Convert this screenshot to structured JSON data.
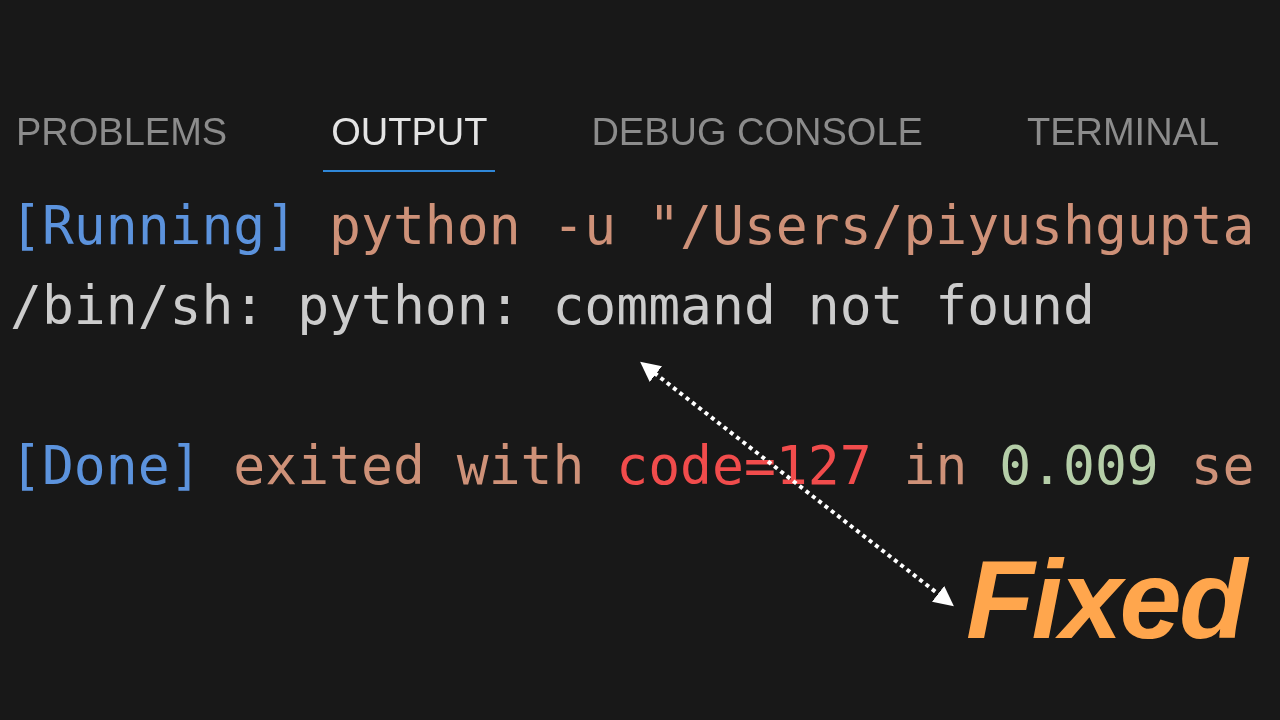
{
  "tabs": [
    {
      "label": "PROBLEMS",
      "selected": false
    },
    {
      "label": "OUTPUT",
      "selected": true
    },
    {
      "label": "DEBUG CONSOLE",
      "selected": false
    },
    {
      "label": "TERMINAL",
      "selected": false
    }
  ],
  "output_lines": [
    {
      "kind": "text",
      "segments": [
        {
          "kind": "tag",
          "text": "[Running]"
        },
        {
          "kind": "string",
          "text": " python -u \"/Users/piyushgupta"
        }
      ]
    },
    {
      "kind": "text",
      "segments": [
        {
          "kind": "plain",
          "text": "/bin/sh: python: command not found"
        }
      ]
    },
    {
      "kind": "blank"
    },
    {
      "kind": "text",
      "segments": [
        {
          "kind": "tag",
          "text": "[Done]"
        },
        {
          "kind": "string",
          "text": " exited with "
        },
        {
          "kind": "error",
          "text": "code=127"
        },
        {
          "kind": "string",
          "text": " in "
        },
        {
          "kind": "number",
          "text": "0.009"
        },
        {
          "kind": "string",
          "text": " se"
        }
      ]
    }
  ],
  "annotation": {
    "label": "Fixed"
  }
}
